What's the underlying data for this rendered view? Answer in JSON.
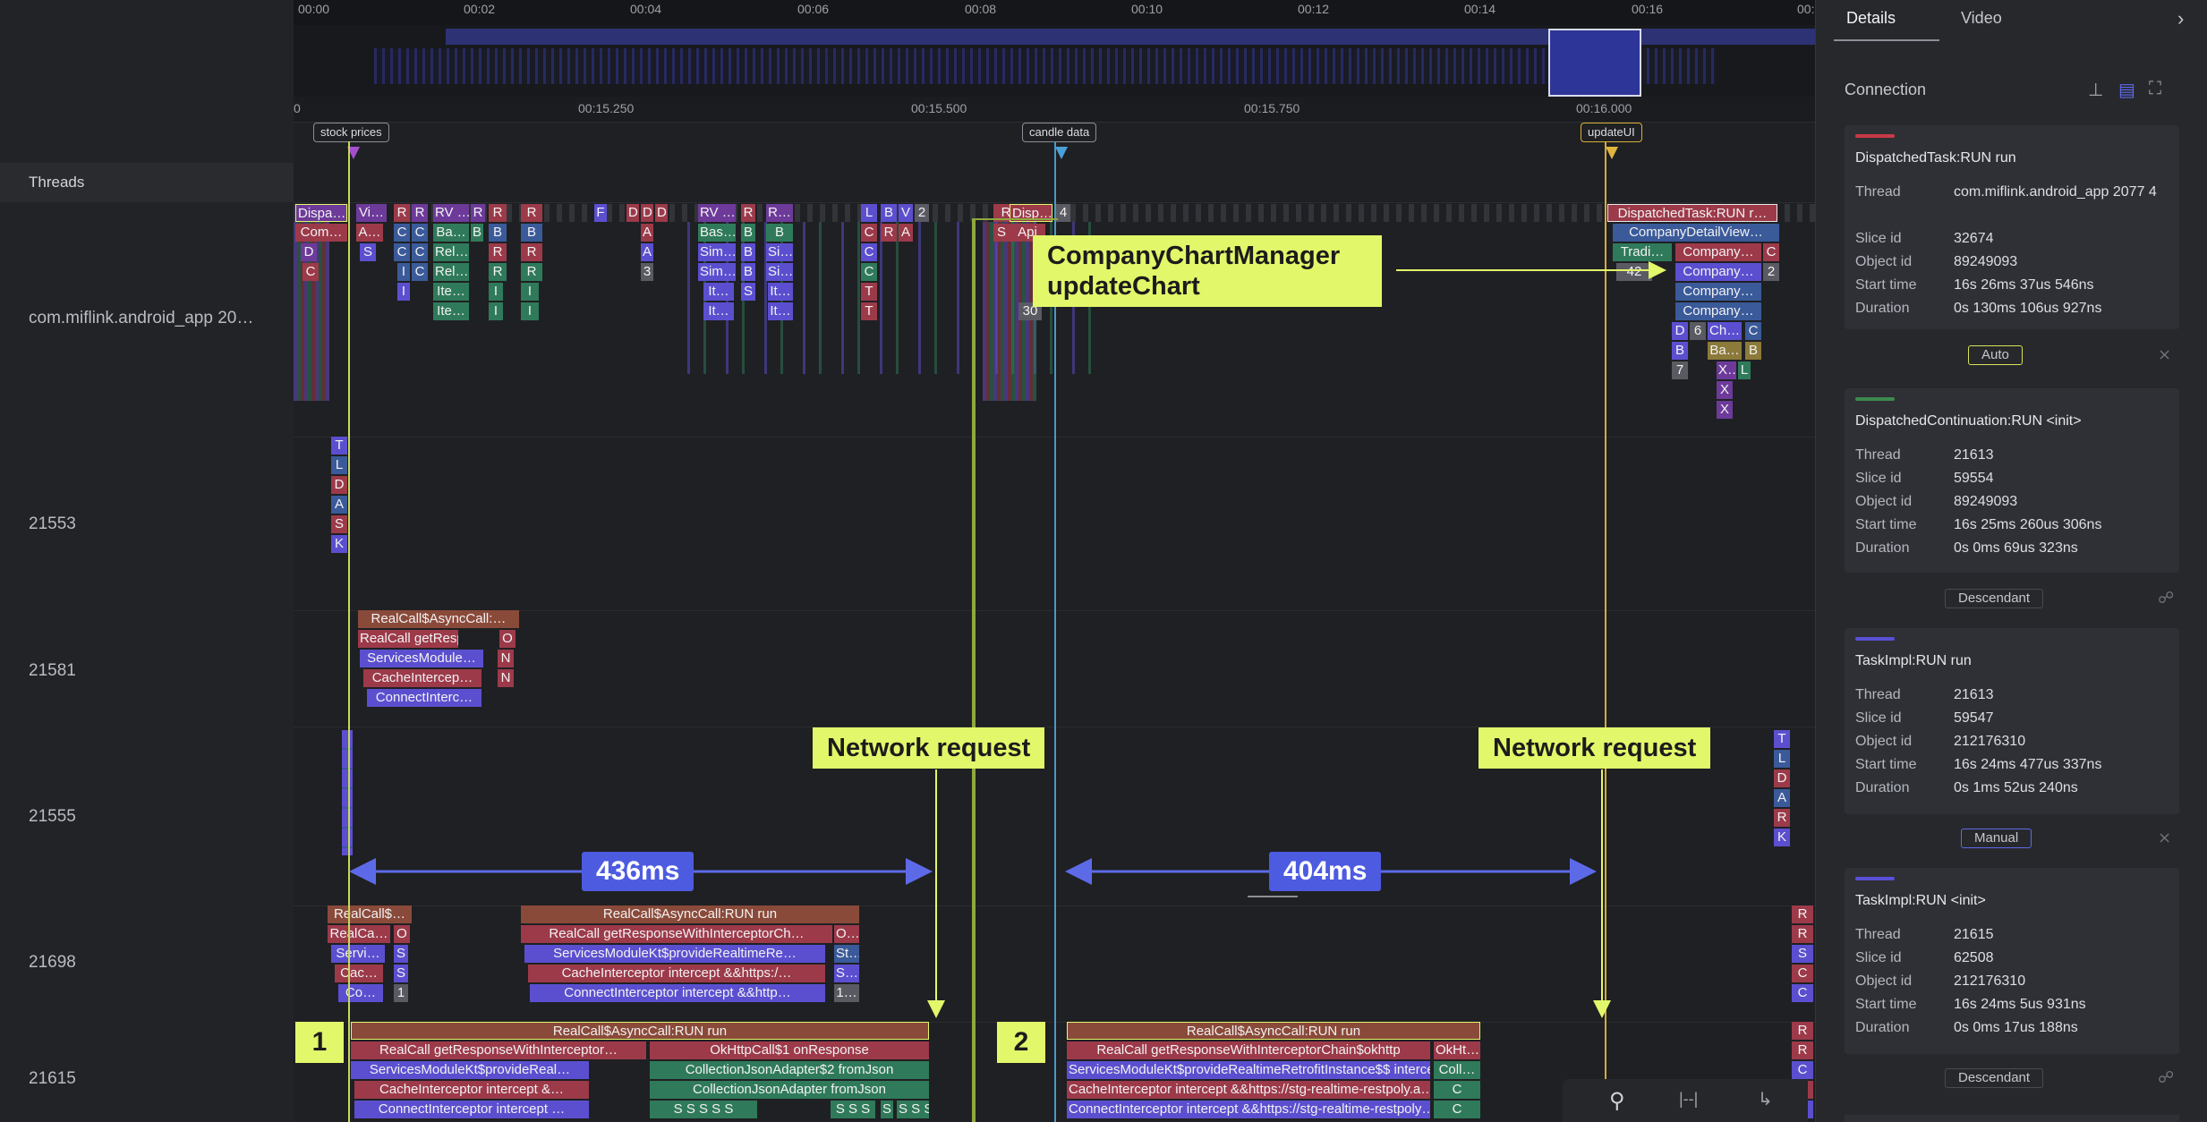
{
  "timeline": {
    "top_ticks": [
      "00:00",
      "00:02",
      "00:04",
      "00:06",
      "00:08",
      "00:10",
      "00:12",
      "00:14",
      "00:16",
      "00:"
    ],
    "sub_ticks": [
      "0",
      "00:15.250",
      "00:15.500",
      "00:15.750",
      "00:16.000"
    ],
    "markers": [
      "stock prices",
      "candle data",
      "updateUI"
    ],
    "a_badge": "A"
  },
  "threads": {
    "header": "Threads",
    "rows": [
      "com.miflink.android_app 20…",
      "21553",
      "21581",
      "21555",
      "21698",
      "21615"
    ]
  },
  "slices": {
    "main_top": [
      "Dispa…",
      "Vi…",
      "R",
      "R",
      "RV …",
      "R",
      "R",
      "R",
      "F",
      "D",
      "D",
      "D",
      "RV …",
      "R",
      "R…",
      "L",
      "B",
      "V",
      "2",
      "R",
      "Disp…",
      "4",
      "DispatchedTask:RUN r…"
    ],
    "main_second": [
      "Com…",
      "A…",
      "C",
      "C",
      "Ba…",
      "B",
      "B",
      "B",
      "A",
      "Bas…",
      "B",
      "B",
      "C",
      "R",
      "A",
      "S",
      "Api",
      "CompanyDetailView…"
    ],
    "main_third": [
      "D",
      "S",
      "C",
      "C",
      "Rel…",
      "R",
      "R",
      "A",
      "Sim…",
      "B",
      "Si…",
      "C",
      "Tradi…",
      "Company…",
      "C"
    ],
    "main_fourth": [
      "C",
      "I",
      "C",
      "Rel…",
      "R",
      "R",
      "3",
      "Sim…",
      "B",
      "Si…",
      "C",
      "42",
      "Company…",
      "2"
    ],
    "main_fifth": [
      "I",
      "Ite…",
      "I",
      "I",
      "It…",
      "S",
      "It…",
      "T",
      "Company…"
    ],
    "main_sixth": [
      "Ite…",
      "I",
      "I",
      "It…",
      "It…",
      "T",
      "30",
      "Company…"
    ],
    "right_stack": [
      "D",
      "6",
      "Ch…",
      "C",
      "B",
      "Ba…",
      "B",
      "7",
      "X…",
      "L",
      "X",
      "X"
    ],
    "t21553": [
      "T",
      "L",
      "D",
      "A",
      "S",
      "K"
    ],
    "t21581": [
      "RealCall$AsyncCall:…",
      "O",
      "RealCall getResp…",
      "O",
      "ServicesModule…",
      "N",
      "CacheIntercep…",
      "N",
      "ConnectInterc…"
    ],
    "t21555_right": [
      "T",
      "L",
      "D",
      "A",
      "R",
      "K"
    ],
    "t21698_left": [
      "RealCall$…",
      "RealCa…",
      "O",
      "Servi…",
      "S",
      "Cac…",
      "S",
      "Co…",
      "1"
    ],
    "t21698_mid": [
      "RealCall$AsyncCall:RUN run",
      "RealCall getResponseWithInterceptorCh…",
      "O…",
      "ServicesModuleKt$provideRealtimeRe…",
      "St…",
      "CacheInterceptor intercept &&https:/…",
      "S…",
      "ConnectInterceptor intercept &&http…",
      "1…"
    ],
    "t21698_right": [
      "R",
      "R",
      "S",
      "C",
      "C"
    ],
    "t21615_a": [
      "RealCall$AsyncCall:RUN run",
      "RealCall getResponseWithInterceptor…",
      "OkHttpCall$1 onResponse",
      "ServicesModuleKt$provideReal…",
      "CollectionJsonAdapter$2 fromJson",
      "CacheInterceptor intercept &…",
      "CollectionJsonAdapter fromJson",
      "ConnectInterceptor intercept …",
      "S S S S S",
      "S S S",
      "S",
      "S S S"
    ],
    "t21615_b": [
      "RealCall$AsyncCall:RUN run",
      "RealCall getResponseWithInterceptorChain$okhttp",
      "OkHt…",
      "ServicesModuleKt$provideRealtimeRetrofitInstance$$ intercept",
      "Coll…",
      "CacheInterceptor intercept &&https://stg-realtime-restpoly.a…",
      "C",
      "ConnectInterceptor intercept &&https://stg-realtime-restpoly…",
      "C"
    ],
    "t21615_right": [
      "R",
      "R",
      "C",
      "C",
      "C"
    ]
  },
  "annotations": {
    "callout_chart": "CompanyChartManager\nupdateChart",
    "callout_chart_line1": "CompanyChartManager",
    "callout_chart_line2": "updateChart",
    "network_1": "Network request",
    "network_2": "Network request",
    "duration_1": "436ms",
    "duration_2": "404ms",
    "badge_1": "1",
    "badge_2": "2"
  },
  "toolbar": {
    "icons": [
      "search-icon",
      "range-icon",
      "flow-icon"
    ]
  },
  "right_panel": {
    "tabs": [
      "Details",
      "Video"
    ],
    "section_title": "Connection",
    "cards": [
      {
        "title": "DispatchedTask:RUN run",
        "bar_color": "#c83a47",
        "thread": "com.miflink.android_app 2077 4",
        "slice_id": "32674",
        "object_id": "89249093",
        "start_time": "16s 26ms 37us 546ns",
        "duration": "0s 130ms 106us 927ns"
      },
      {
        "title": "DispatchedContinuation:RUN <init>",
        "bar_color": "#3d8a4e",
        "thread": "21613",
        "slice_id": "59554",
        "object_id": "89249093",
        "start_time": "16s 25ms 260us 306ns",
        "duration": "0s 0ms 69us 323ns"
      },
      {
        "title": "TaskImpl:RUN run",
        "bar_color": "#5a4fd6",
        "thread": "21613",
        "slice_id": "59547",
        "object_id": "212176310",
        "start_time": "16s 24ms 477us 337ns",
        "duration": "0s 1ms 52us 240ns"
      },
      {
        "title": "TaskImpl:RUN <init>",
        "bar_color": "#5a4fd6",
        "thread": "21615",
        "slice_id": "62508",
        "object_id": "212176310",
        "start_time": "16s 24ms 5us 931ns",
        "duration": "0s 0ms 17us 188ns"
      }
    ],
    "field_labels": {
      "thread": "Thread",
      "slice_id": "Slice id",
      "object_id": "Object id",
      "start_time": "Start time",
      "duration": "Duration"
    },
    "relations": [
      {
        "label": "Auto",
        "border": "#d8e25a"
      },
      {
        "label": "Descendant",
        "border": "#4a4b52"
      },
      {
        "label": "Manual",
        "border": "#5d6ae8"
      },
      {
        "label": "Descendant",
        "border": "#4a4b52"
      }
    ]
  }
}
